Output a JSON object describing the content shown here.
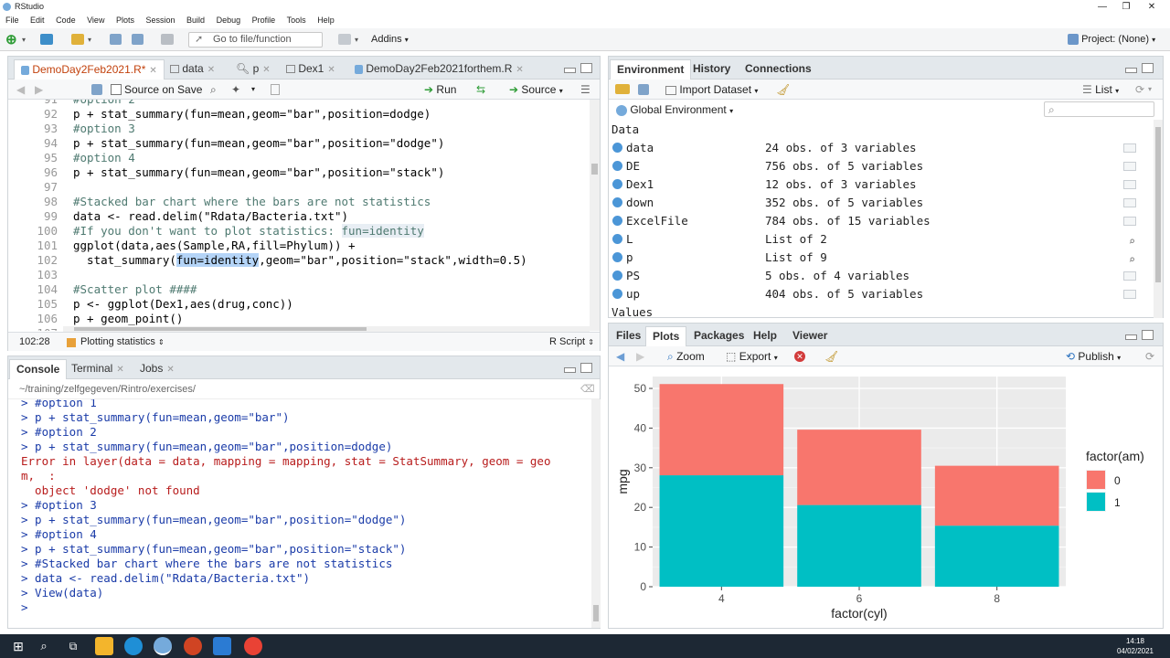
{
  "window": {
    "title": "RStudio"
  },
  "menu": [
    "File",
    "Edit",
    "Code",
    "View",
    "Plots",
    "Session",
    "Build",
    "Debug",
    "Profile",
    "Tools",
    "Help"
  ],
  "toolbar": {
    "goto_placeholder": "Go to file/function",
    "addins": "Addins",
    "project": "Project: (None)"
  },
  "editor": {
    "tabs": [
      {
        "label": "DemoDay2Feb2021.R*",
        "active": true
      },
      {
        "label": "data",
        "active": false
      },
      {
        "label": "p",
        "active": false
      },
      {
        "label": "Dex1",
        "active": false
      },
      {
        "label": "DemoDay2Feb2021forthem.R",
        "active": false
      }
    ],
    "source_on_save": "Source on Save",
    "run_label": "Run",
    "source_label": "Source",
    "lines": [
      {
        "n": "91",
        "text": "#option 2",
        "kind": "cm"
      },
      {
        "n": "92",
        "text": "p + stat_summary(fun=mean,geom=\"bar\",position=dodge)",
        "kind": "code"
      },
      {
        "n": "93",
        "text": "#option 3",
        "kind": "cm"
      },
      {
        "n": "94",
        "text": "p + stat_summary(fun=mean,geom=\"bar\",position=\"dodge\")",
        "kind": "code"
      },
      {
        "n": "95",
        "text": "#option 4",
        "kind": "cm"
      },
      {
        "n": "96",
        "text": "p + stat_summary(fun=mean,geom=\"bar\",position=\"stack\")",
        "kind": "code"
      },
      {
        "n": "97",
        "text": "",
        "kind": "code"
      },
      {
        "n": "98",
        "text": "#Stacked bar chart where the bars are not statistics",
        "kind": "cm"
      },
      {
        "n": "99",
        "text": "data <- read.delim(\"Rdata/Bacteria.txt\")",
        "kind": "code"
      },
      {
        "n": "100",
        "text": "#If you don't want to plot statistics: fun=identity",
        "kind": "cm"
      },
      {
        "n": "101",
        "text": "ggplot(data,aes(Sample,RA,fill=Phylum)) +",
        "kind": "code"
      },
      {
        "n": "102",
        "text": "  stat_summary(fun=identity,geom=\"bar\",position=\"stack\",width=0.5)",
        "kind": "code"
      },
      {
        "n": "103",
        "text": "",
        "kind": "code"
      },
      {
        "n": "104",
        "text": "#Scatter plot ####",
        "kind": "cm"
      },
      {
        "n": "105",
        "text": "p <- ggplot(Dex1,aes(drug,conc))",
        "kind": "code"
      },
      {
        "n": "106",
        "text": "p + geom_point()",
        "kind": "code"
      },
      {
        "n": "107",
        "text": "",
        "kind": "code"
      }
    ],
    "status_pos": "102:28",
    "status_section": "Plotting statistics",
    "status_lang": "R Script"
  },
  "console": {
    "tabs": [
      "Console",
      "Terminal",
      "Jobs"
    ],
    "path": "~/training/zelfgegeven/Rintro/exercises/",
    "lines": [
      {
        "text": "> #option 1",
        "kind": "blue"
      },
      {
        "text": "> p + stat_summary(fun=mean,geom=\"bar\")",
        "kind": "blue"
      },
      {
        "text": "> #option 2",
        "kind": "blue"
      },
      {
        "text": "> p + stat_summary(fun=mean,geom=\"bar\",position=dodge)",
        "kind": "blue"
      },
      {
        "text": "Error in layer(data = data, mapping = mapping, stat = StatSummary, geom = geo",
        "kind": "red"
      },
      {
        "text": "m,  :",
        "kind": "red"
      },
      {
        "text": "  object 'dodge' not found",
        "kind": "red"
      },
      {
        "text": "> #option 3",
        "kind": "blue"
      },
      {
        "text": "> p + stat_summary(fun=mean,geom=\"bar\",position=\"dodge\")",
        "kind": "blue"
      },
      {
        "text": "> #option 4",
        "kind": "blue"
      },
      {
        "text": "> p + stat_summary(fun=mean,geom=\"bar\",position=\"stack\")",
        "kind": "blue"
      },
      {
        "text": "> #Stacked bar chart where the bars are not statistics",
        "kind": "blue"
      },
      {
        "text": "> data <- read.delim(\"Rdata/Bacteria.txt\")",
        "kind": "blue"
      },
      {
        "text": "> View(data)",
        "kind": "blue"
      },
      {
        "text": "> ",
        "kind": "blue"
      }
    ]
  },
  "environment": {
    "tabs": [
      "Environment",
      "History",
      "Connections"
    ],
    "import_label": "Import Dataset",
    "list_label": "List",
    "scope_label": "Global Environment",
    "data_header": "Data",
    "values_header": "Values",
    "rows": [
      {
        "name": "data",
        "value": "24 obs. of 3 variables",
        "icon": "grid"
      },
      {
        "name": "DE",
        "value": "756 obs. of 5 variables",
        "icon": "grid"
      },
      {
        "name": "Dex1",
        "value": "12 obs. of 3 variables",
        "icon": "grid"
      },
      {
        "name": "down",
        "value": "352 obs. of 5 variables",
        "icon": "grid"
      },
      {
        "name": "ExcelFile",
        "value": "784 obs. of 15 variables",
        "icon": "grid"
      },
      {
        "name": "L",
        "value": "List of 2",
        "icon": "search"
      },
      {
        "name": "p",
        "value": "List of 9",
        "icon": "search"
      },
      {
        "name": "PS",
        "value": "5 obs. of 4 variables",
        "icon": "grid"
      },
      {
        "name": "up",
        "value": "404 obs. of 5 variables",
        "icon": "grid"
      }
    ]
  },
  "files_pane": {
    "tabs": [
      "Files",
      "Plots",
      "Packages",
      "Help",
      "Viewer"
    ],
    "zoom_label": "Zoom",
    "export_label": "Export",
    "publish_label": "Publish"
  },
  "chart_data": {
    "type": "bar",
    "stacked": true,
    "categories": [
      "4",
      "6",
      "8"
    ],
    "series": [
      {
        "name": "0",
        "values": [
          23.0,
          19.0,
          15.1
        ],
        "color": "#f8766d"
      },
      {
        "name": "1",
        "values": [
          28.1,
          20.6,
          15.4
        ],
        "color": "#00bfc4"
      }
    ],
    "xlabel": "factor(cyl)",
    "ylabel": "mpg",
    "legend_title": "factor(am)",
    "ylim": [
      0,
      53
    ],
    "yticks": [
      0,
      10,
      20,
      30,
      40,
      50
    ],
    "legend_position": "right",
    "grid": true,
    "panel_bg": "#ebebeb"
  },
  "taskbar": {
    "time": "14:18",
    "date": "04/02/2021"
  }
}
